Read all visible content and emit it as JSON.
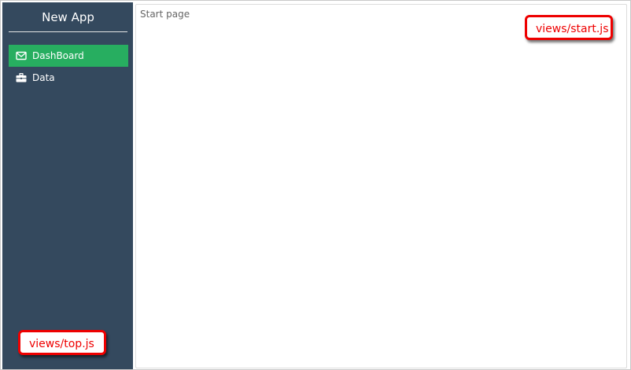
{
  "app": {
    "title": "New App"
  },
  "sidebar": {
    "items": [
      {
        "label": "DashBoard",
        "icon": "envelope-icon",
        "active": true
      },
      {
        "label": "Data",
        "icon": "briefcase-icon",
        "active": false
      }
    ]
  },
  "main": {
    "page_label": "Start page"
  },
  "annotations": {
    "start_view": "views/start.js",
    "top_view": "views/top.js"
  },
  "colors": {
    "sidebar_bg": "#34495e",
    "active_item": "#27ae60",
    "annotation": "#ee0000"
  }
}
